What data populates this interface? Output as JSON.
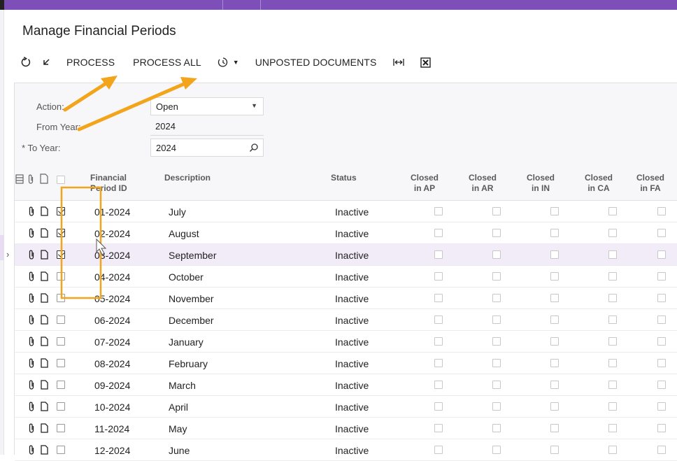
{
  "page": {
    "title": "Manage Financial Periods"
  },
  "toolbar": {
    "refresh_icon": "refresh-icon",
    "undo_icon": "undo-icon",
    "process_label": "PROCESS",
    "process_all_label": "PROCESS ALL",
    "schedule_icon": "schedule-icon",
    "unposted_label": "UNPOSTED DOCUMENTS",
    "fit_icon": "fit-columns-icon",
    "excel_icon": "export-excel-icon"
  },
  "form": {
    "action_label": "Action:",
    "action_value": "Open",
    "from_year_label": "From Year:",
    "from_year_value": "2024",
    "to_year_required": "*",
    "to_year_label": "To Year:",
    "to_year_value": "2024"
  },
  "grid": {
    "headers": {
      "period_id_1": "Financial",
      "period_id_2": "Period ID",
      "description": "Description",
      "status": "Status",
      "ap_1": "Closed",
      "ap_2": "in AP",
      "ar_1": "Closed",
      "ar_2": "in AR",
      "in_1": "Closed",
      "in_2": "in IN",
      "ca_1": "Closed",
      "ca_2": "in CA",
      "fa_1": "Closed",
      "fa_2": "in FA"
    },
    "rows": [
      {
        "id": "01-2024",
        "description": "July",
        "status": "Inactive",
        "selected": true
      },
      {
        "id": "02-2024",
        "description": "August",
        "status": "Inactive",
        "selected": true
      },
      {
        "id": "03-2024",
        "description": "September",
        "status": "Inactive",
        "selected": true
      },
      {
        "id": "04-2024",
        "description": "October",
        "status": "Inactive",
        "selected": false
      },
      {
        "id": "05-2024",
        "description": "November",
        "status": "Inactive",
        "selected": false
      },
      {
        "id": "06-2024",
        "description": "December",
        "status": "Inactive",
        "selected": false
      },
      {
        "id": "07-2024",
        "description": "January",
        "status": "Inactive",
        "selected": false
      },
      {
        "id": "08-2024",
        "description": "February",
        "status": "Inactive",
        "selected": false
      },
      {
        "id": "09-2024",
        "description": "March",
        "status": "Inactive",
        "selected": false
      },
      {
        "id": "10-2024",
        "description": "April",
        "status": "Inactive",
        "selected": false
      },
      {
        "id": "11-2024",
        "description": "May",
        "status": "Inactive",
        "selected": false
      },
      {
        "id": "12-2024",
        "description": "June",
        "status": "Inactive",
        "selected": false
      }
    ],
    "active_row": 2
  },
  "colors": {
    "accent": "#7e4fb8",
    "annotation": "#f2a51b",
    "selected_row": "#f2ecf8"
  }
}
